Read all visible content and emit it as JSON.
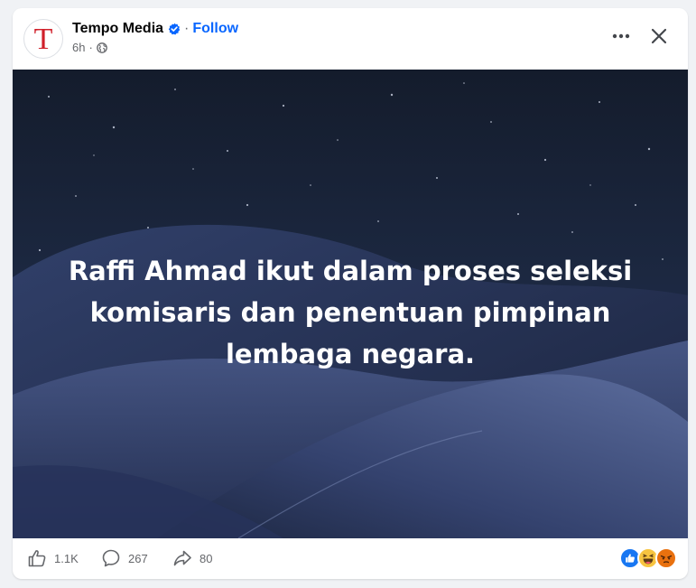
{
  "post": {
    "page_name": "Tempo Media",
    "avatar_letter": "T",
    "follow_label": "Follow",
    "separator": "·",
    "time": "6h",
    "more_icon": "more-horizontal-icon",
    "close_icon": "close-icon",
    "verified_icon": "verified-badge-icon",
    "privacy_icon": "globe-icon"
  },
  "image": {
    "text_lines": [
      "Raffi Ahmad ikut dalam proses seleksi",
      "komisaris dan penentuan pimpinan",
      "lembaga negara."
    ]
  },
  "engagement": {
    "likes": "1.1K",
    "comments": "267",
    "shares": "80",
    "reaction_icons": [
      "like-reaction-icon",
      "haha-reaction-icon",
      "angry-reaction-icon"
    ]
  },
  "colors": {
    "accent": "#0866ff",
    "avatar_letter": "#d0202a",
    "text_primary": "#050505",
    "text_secondary": "#65676b"
  }
}
